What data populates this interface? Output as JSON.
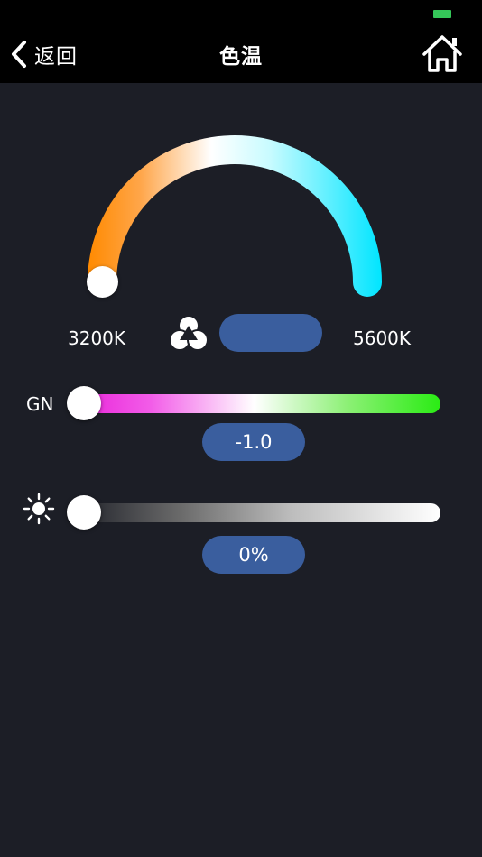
{
  "header": {
    "back_label": "返回",
    "title": "色温",
    "icons": {
      "back": "chevron-left-icon",
      "home": "home-icon"
    }
  },
  "status_bar": {
    "battery_color": "#35c759"
  },
  "cct": {
    "min_label": "3200K",
    "max_label": "5600K",
    "value_text": "",
    "gradient_colors": [
      "#ff8a00",
      "#ffffff",
      "#00e5ff"
    ],
    "level": 0
  },
  "gn": {
    "label": "GN",
    "value_text": "-1.0",
    "gradient_colors": [
      "#e81ed8",
      "#ffffff",
      "#2aec14"
    ],
    "level": 0
  },
  "brightness": {
    "icon": "sun-icon",
    "value_text": "0%",
    "level": 0
  },
  "colors": {
    "background": "#1c1e26",
    "topbar": "#000000",
    "pill": "#3a5e9e"
  }
}
